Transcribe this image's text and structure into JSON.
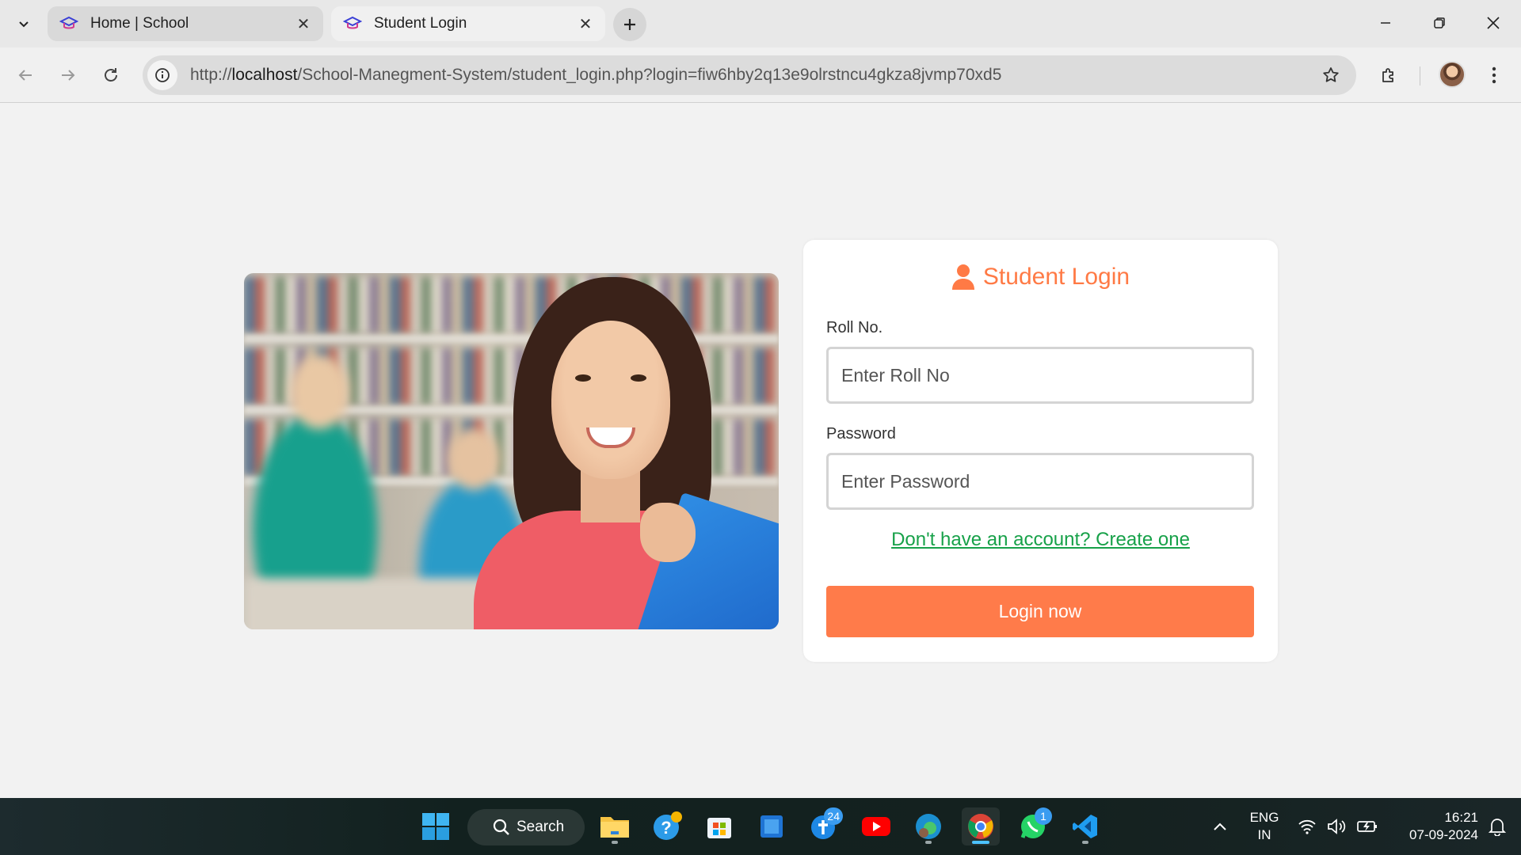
{
  "browser": {
    "tabs": [
      {
        "title": "Home | School",
        "active": false
      },
      {
        "title": "Student Login",
        "active": true
      }
    ],
    "url_prefix": "http://",
    "url_host": "localhost",
    "url_path": "/School-Manegment-System/student_login.php?login=fiw6hby2q13e9olrstncu4gkza8jvmp70xd5"
  },
  "login": {
    "title": "Student Login",
    "roll_label": "Roll No.",
    "roll_placeholder": "Enter Roll No",
    "password_label": "Password",
    "password_placeholder": "Enter Password",
    "signup_link": "Don't have an account? Create one",
    "submit_label": "Login now"
  },
  "colors": {
    "accent": "#ff7b4a",
    "link": "#17a149"
  },
  "taskbar": {
    "search_label": "Search",
    "apps": [
      {
        "name": "file-explorer",
        "badge": ""
      },
      {
        "name": "get-help",
        "badge": ""
      },
      {
        "name": "microsoft-store",
        "badge": ""
      },
      {
        "name": "app-blue",
        "badge": ""
      },
      {
        "name": "app-cross",
        "badge": "24"
      },
      {
        "name": "youtube",
        "badge": ""
      },
      {
        "name": "edge",
        "badge": ""
      },
      {
        "name": "chrome",
        "badge": ""
      },
      {
        "name": "whatsapp",
        "badge": "1"
      },
      {
        "name": "vscode",
        "badge": ""
      }
    ],
    "language_line1": "ENG",
    "language_line2": "IN",
    "time": "16:21",
    "date": "07-09-2024"
  }
}
